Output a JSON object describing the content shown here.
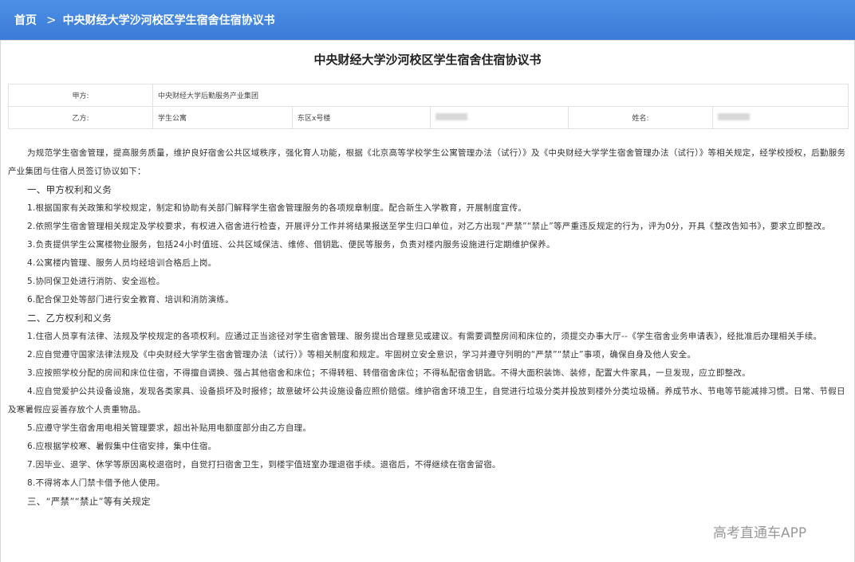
{
  "breadcrumb": {
    "home": "首页",
    "current": "中央财经大学沙河校区学生宿舍住宿协议书"
  },
  "doc": {
    "title": "中央财经大学沙河校区学生宿舍住宿协议书"
  },
  "info": {
    "party_a_label": "甲方:",
    "party_a_value": "中央财经大学后勤服务产业集团",
    "party_b_label": "乙方:",
    "party_b_value": "学生公寓",
    "building": "东区x号楼",
    "name_label": "姓名:"
  },
  "body": {
    "intro": "为规范学生宿舍管理，提高服务质量，维护良好宿舍公共区域秩序，强化育人功能，根据《北京高等学校学生公寓管理办法（试行）》及《中央财经大学学生宿舍管理办法（试行）》等相关规定，经学校授权，后勤服务产业集团与住宿人员签订协议如下：",
    "sec1": "一、甲方权利和义务",
    "a1": "1.根据国家有关政策和学校规定，制定和协助有关部门解释学生宿舍管理服务的各项规章制度。配合新生入学教育，开展制度宣传。",
    "a2": "2.依照学生宿舍管理相关规定及学校要求，有权进入宿舍进行检查，开展评分工作并将结果报送至学生归口单位，对乙方出现“严禁”“禁止”等严重违反规定的行为，评为0分，开具《整改告知书》，要求立即整改。",
    "a3": "3.负责提供学生公寓楼物业服务，包括24小时值班、公共区域保洁、维修、借钥匙、便民等服务，负责对楼内服务设施进行定期维护保养。",
    "a4": "4.公寓楼内管理、服务人员均经培训合格后上岗。",
    "a5": "5.协同保卫处进行消防、安全巡检。",
    "a6": "6.配合保卫处等部门进行安全教育、培训和消防演练。",
    "sec2": "二、乙方权利和义务",
    "b1": "1.住宿人员享有法律、法规及学校规定的各项权利。应通过正当途径对学生宿舍管理、服务提出合理意见或建议。有需要调整房间和床位的，须提交办事大厅--《学生宿舍业务申请表》，经批准后办理相关手续。",
    "b2": "2.应自觉遵守国家法律法规及《中央财经大学学生宿舍管理办法（试行）》等相关制度和规定。牢固树立安全意识，学习并遵守列明的“严禁”“禁止”事项，确保自身及他人安全。",
    "b3": "3.应按照学校分配的房间和床位住宿，不得擅自调换、强占其他宿舍和床位；不得转租、转借宿舍床位；不得私配宿舍钥匙。不得大面积装饰、装修，配置大件家具，一旦发现，应立即整改。",
    "b4": "4.应自觉爱护公共设备设施，发现各类家具、设备损坏及时报修；故意破坏公共设施设备应照价赔偿。维护宿舍环境卫生，自觉进行垃圾分类并投放到楼外分类垃圾桶。养成节水、节电等节能减排习惯。日常、节假日及寒暑假应妥善存放个人贵重物品。",
    "b5": "5.应遵守学生宿舍用电相关管理要求，超出补贴用电额度部分由乙方自理。",
    "b6": "6.应根据学校寒、暑假集中住宿安排，集中住宿。",
    "b7": "7.因毕业、退学、休学等原因离校退宿时，自觉打扫宿舍卫生，到楼宇值班室办理退宿手续。退宿后，不得继续在宿舍留宿。",
    "b8": "8.不得将本人门禁卡借予他人使用。",
    "sec3": "三、“严禁”“禁止”等有关规定"
  },
  "watermark": "高考直通车APP"
}
